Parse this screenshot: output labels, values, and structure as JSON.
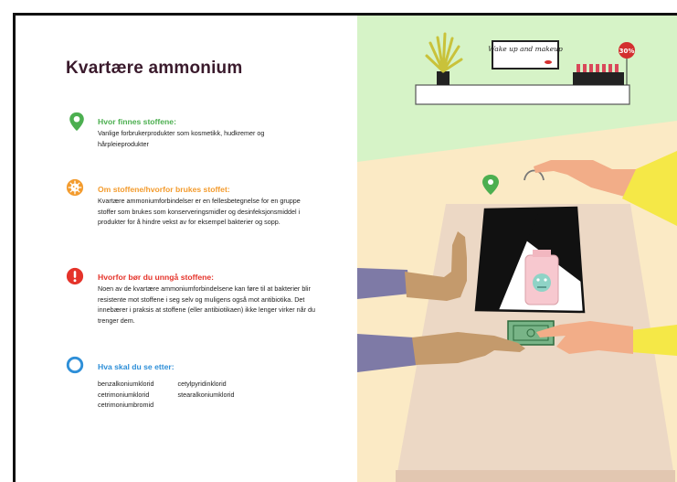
{
  "title": "Kvartære ammonium",
  "colors": {
    "title": "#3a1a2c",
    "green": "#4caf50",
    "orange": "#f39b2d",
    "red": "#e5332a",
    "blue": "#2e8fd8"
  },
  "sections": [
    {
      "icon": "location-pin-icon",
      "heading": "Hvor finnes stoffene:",
      "body": "Vanlige forbrukerprodukter som kosmetikk, hudkremer og hårpleieprodukter"
    },
    {
      "icon": "bacteria-icon",
      "heading": "Om stoffene/hvorfor brukes stoffet:",
      "body": "Kvartære ammoniumforbindelser er en fellesbetegnelse for en gruppe stoffer som brukes som konserveringsmidler og desinfeksjonsmiddel i produkter for å hindre vekst av for eksempel bakterier og sopp."
    },
    {
      "icon": "warning-icon",
      "heading": "Hvorfor bør du unngå stoffene:",
      "body": "Noen av de kvartære ammoniumforbindelsene kan føre til at bakterier blir resistente mot stoffene i seg selv og muligens også mot antibiotika. Det innebærer i praksis at stoffene (eller antibiotikaen) ikke lenger virker når du trenger dem."
    },
    {
      "icon": "circle-icon",
      "heading": "Hva skal du se etter:",
      "body": ""
    }
  ],
  "substances": {
    "col1": [
      "benzalkoniumklorid",
      "cetrimoniumklorid",
      "cetrimoniumbromid"
    ],
    "col2": [
      "cetylpyridinklorid",
      "stearalkoniumklorid"
    ]
  },
  "illustration": {
    "sign_text": "Wake up and makeup",
    "discount_badge": "30%"
  }
}
